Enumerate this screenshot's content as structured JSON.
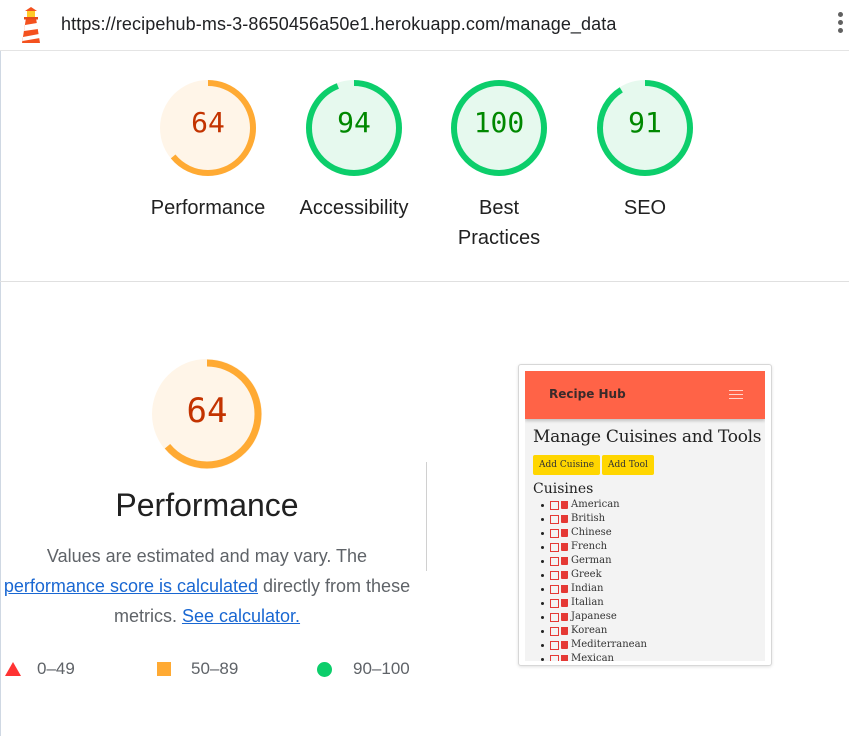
{
  "topbar": {
    "url": "https://recipehub-ms-3-8650456a50e1.herokuapp.com/manage_data",
    "logo": "lighthouse-icon",
    "menu_icon": "vertical-dots-icon"
  },
  "gauges": [
    {
      "label": "Performance",
      "score": "64",
      "value": 64,
      "status": "average"
    },
    {
      "label": "Accessibility",
      "score": "94",
      "value": 94,
      "status": "pass"
    },
    {
      "label": "Best Practices",
      "score": "100",
      "value": 100,
      "status": "pass"
    },
    {
      "label": "SEO",
      "score": "91",
      "value": 91,
      "status": "pass"
    }
  ],
  "colors": {
    "pass": "#0cce6b",
    "pass_text": "#008800",
    "pass_bg": "#e6f9ee",
    "average": "#ffaa33",
    "average_text": "#c33300",
    "average_bg": "#fff5e8",
    "fail": "#ff3333",
    "link": "#1967d2"
  },
  "performance": {
    "score": "64",
    "value": 64,
    "title": "Performance",
    "desc_part1": "Values are estimated and may vary. The",
    "desc_link1": "performance score is calculated",
    "desc_part2": "directly from these metrics.",
    "desc_link2": "See calculator."
  },
  "legend": [
    {
      "range": "0–49",
      "icon": "triangle-icon"
    },
    {
      "range": "50–89",
      "icon": "square-icon"
    },
    {
      "range": "90–100",
      "icon": "circle-icon"
    }
  ],
  "thumbnail": {
    "brand": "Recipe Hub",
    "heading": "Manage Cuisines and Tools",
    "add_cuisine": "Add Cuisine",
    "add_tool": "Add Tool",
    "section": "Cuisines",
    "cuisines": [
      "American",
      "British",
      "Chinese",
      "French",
      "German",
      "Greek",
      "Indian",
      "Italian",
      "Japanese",
      "Korean",
      "Mediterranean",
      "Mexican"
    ],
    "nav_color": "#ff6347",
    "button_color": "#ffd600"
  }
}
